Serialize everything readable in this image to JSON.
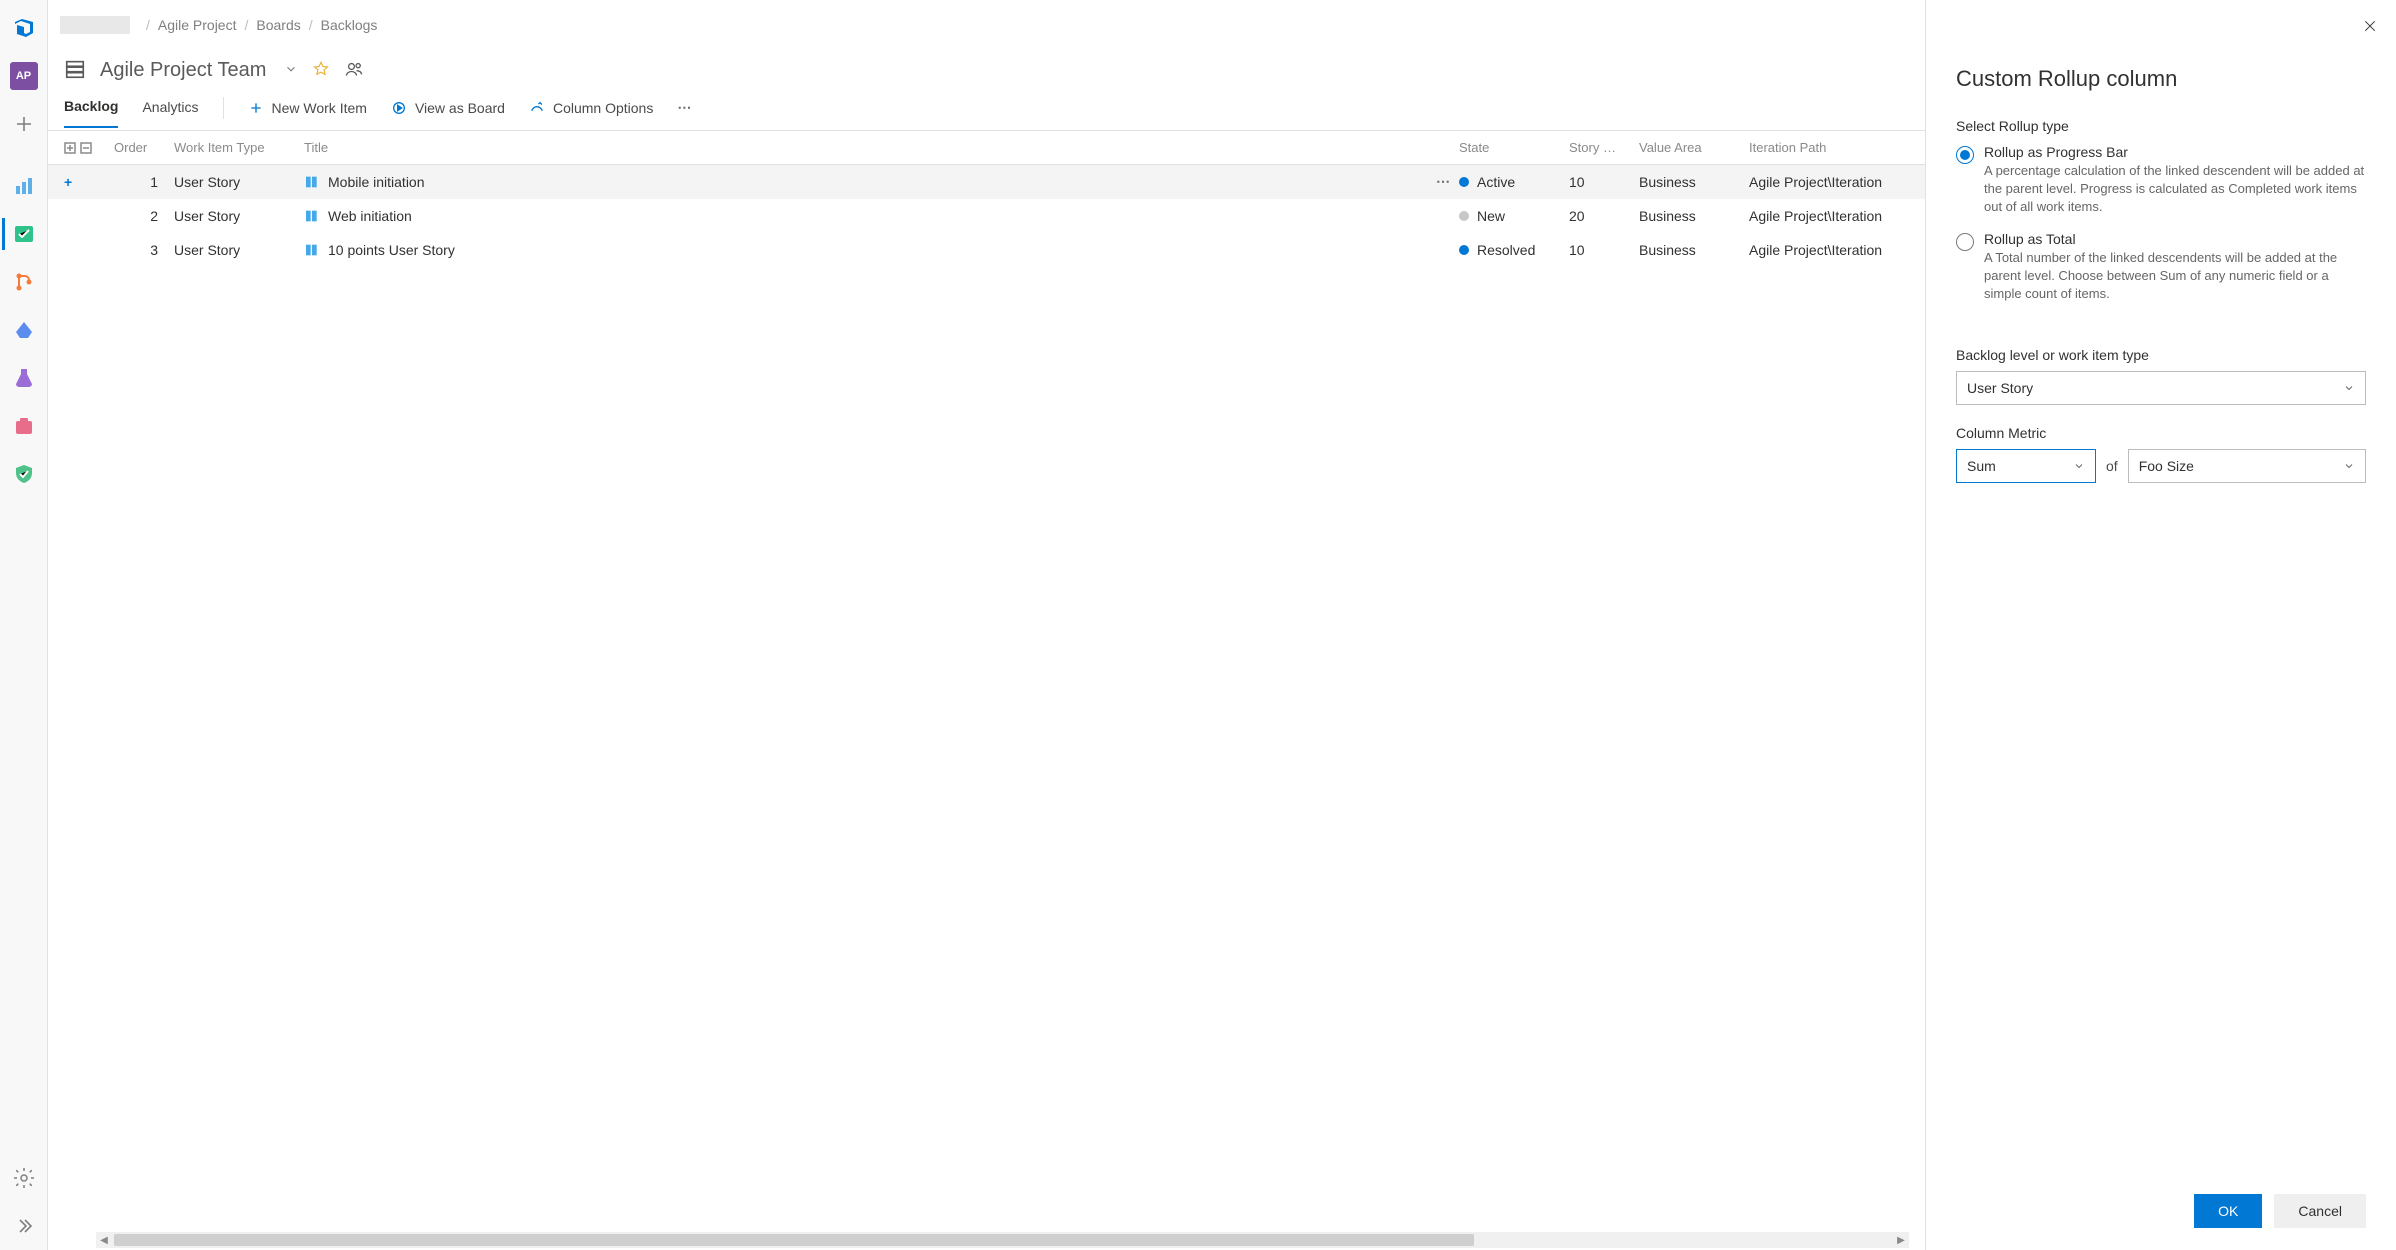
{
  "breadcrumb": {
    "project": "Agile Project",
    "boards": "Boards",
    "backlogs": "Backlogs"
  },
  "team": {
    "name": "Agile Project Team",
    "badge": "AP"
  },
  "tabs": {
    "backlog": "Backlog",
    "analytics": "Analytics"
  },
  "toolbar": {
    "newWorkItem": "New Work Item",
    "viewAsBoard": "View as Board",
    "columnOptions": "Column Options"
  },
  "columns": {
    "order": "Order",
    "workItemType": "Work Item Type",
    "title": "Title",
    "state": "State",
    "storyPoints": "Story …",
    "valueArea": "Value Area",
    "iterationPath": "Iteration Path"
  },
  "rows": [
    {
      "order": "1",
      "type": "User Story",
      "title": "Mobile initiation",
      "state": "Active",
      "stateClass": "active",
      "points": "10",
      "valueArea": "Business",
      "iteration": "Agile Project\\Iteration",
      "hover": true
    },
    {
      "order": "2",
      "type": "User Story",
      "title": "Web initiation",
      "state": "New",
      "stateClass": "new",
      "points": "20",
      "valueArea": "Business",
      "iteration": "Agile Project\\Iteration",
      "hover": false
    },
    {
      "order": "3",
      "type": "User Story",
      "title": "10 points User Story",
      "state": "Resolved",
      "stateClass": "resolved",
      "points": "10",
      "valueArea": "Business",
      "iteration": "Agile Project\\Iteration",
      "hover": false
    }
  ],
  "panel": {
    "title": "Custom Rollup column",
    "selectRollupType": "Select Rollup type",
    "progressBar": {
      "title": "Rollup as Progress Bar",
      "desc": "A percentage calculation of the linked descendent will be added at the parent level. Progress is calculated as Completed work items out of all work items."
    },
    "total": {
      "title": "Rollup as Total",
      "desc": "A Total number of the linked descendents will be added at the parent level. Choose between Sum of any numeric field or a simple count of items."
    },
    "backlogLevelLabel": "Backlog level or work item type",
    "backlogLevelValue": "User Story",
    "columnMetricLabel": "Column Metric",
    "metricAggregation": "Sum",
    "metricOf": "of",
    "metricField": "Foo Size",
    "ok": "OK",
    "cancel": "Cancel"
  }
}
